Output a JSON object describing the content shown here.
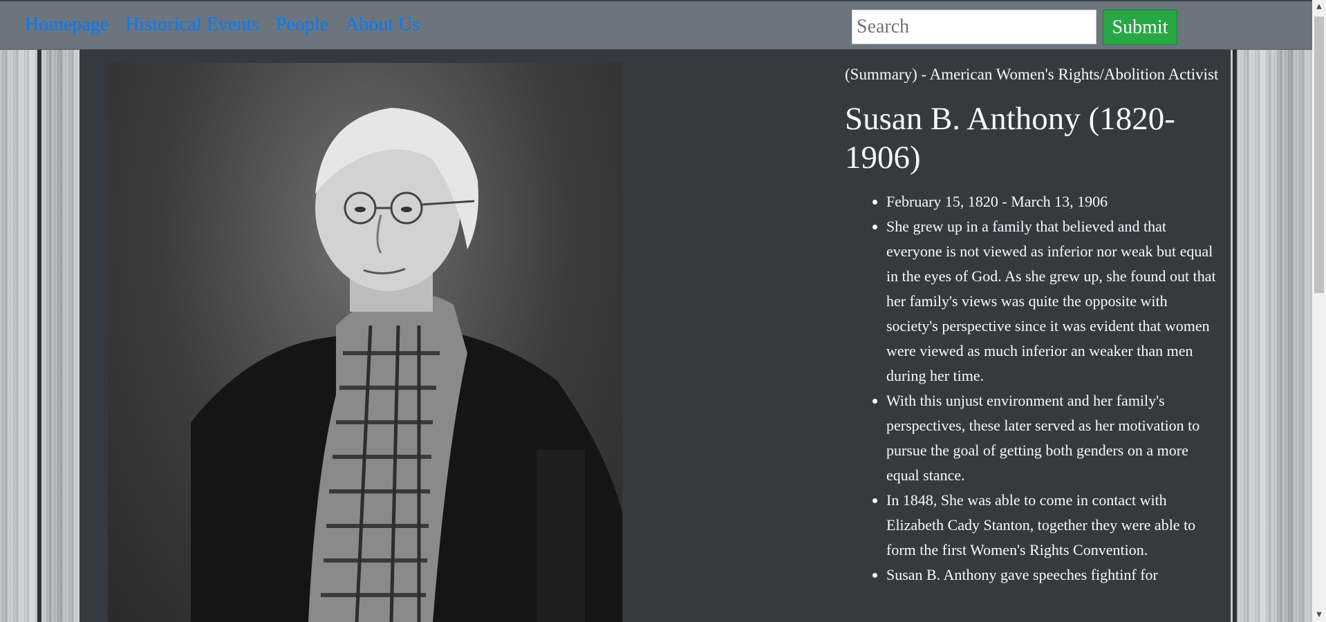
{
  "nav": {
    "links": [
      "Homepage",
      "Historical Events",
      "People",
      "About Us"
    ],
    "search_placeholder": "Search",
    "submit_label": "Submit"
  },
  "article": {
    "summary": "(Summary) - American Women's Rights/Abolition Activist",
    "title": "Susan B. Anthony (1820-1906)",
    "facts": [
      "February 15, 1820 - March 13, 1906",
      "She grew up in a family that believed and that everyone is not viewed as inferior nor weak but equal in the eyes of God. As she grew up, she found out that her family's views was quite the opposite with society's perspective since it was evident that women were viewed as much inferior an weaker than men during her time.",
      "With this unjust environment and her family's perspectives, these later served as her motivation to pursue the goal of getting both genders on a more equal stance.",
      "In 1848, She was able to come in contact with Elizabeth Cady Stanton, together they were able to form the first Women's Rights Convention.",
      "Susan B. Anthony gave speeches fightinf for"
    ]
  },
  "colors": {
    "navbar_bg": "#6c757d",
    "link": "#007bff",
    "submit_bg": "#28a745",
    "content_bg": "#343a40",
    "text": "#f8f9fa"
  },
  "icons": {
    "scroll_up": "triangle-up",
    "scroll_down": "triangle-down"
  }
}
